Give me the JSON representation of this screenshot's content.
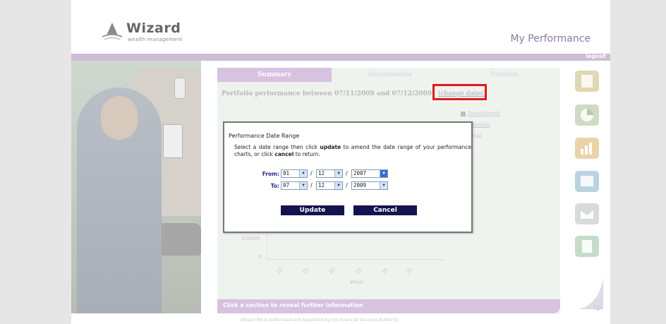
{
  "header": {
    "logo_word": "Wizard",
    "logo_sub": "wealth management",
    "page_heading": "My Performance",
    "logout_label": "logout"
  },
  "tabs": [
    {
      "label": "Summary",
      "active": true
    },
    {
      "label": "Investments",
      "active": false
    },
    {
      "label": "Pension",
      "active": false
    }
  ],
  "summary": {
    "performance_line": "Portfolio performance between 07/11/2009 and 07/12/2009",
    "change_dates_label": "(change dates)"
  },
  "legend": [
    {
      "label": "Investment"
    },
    {
      "label": "Pension"
    },
    {
      "label": "Total"
    }
  ],
  "chart": {
    "y_labels": [
      "100000",
      "0"
    ],
    "x_ticks": [
      "10",
      "15",
      "20",
      "25",
      "30",
      "35"
    ],
    "x_label": "Week"
  },
  "footer": {
    "bar_text": "Click a section to reveal further information",
    "disclaimer": "Wizard IFA is Authorised and Regulated by the Financial Services Authority"
  },
  "modal": {
    "title": "Performance Date Range",
    "text_1": "Select a date range then click ",
    "text_update": "update",
    "text_2": " to amend the date range of your performance charts, or click ",
    "text_cancel": "cancel",
    "text_3": " to return.",
    "from_label": "From:",
    "to_label": "To:",
    "from": {
      "day": "01",
      "month": "12",
      "year": "2007"
    },
    "to": {
      "day": "07",
      "month": "12",
      "year": "2009"
    },
    "update_label": "Update",
    "cancel_label": "Cancel"
  },
  "brand_mark_text": "tp",
  "colors": {
    "accent_purple": "#d7c2df",
    "button_navy": "#13134f",
    "highlight_red": "#e21a1a"
  }
}
